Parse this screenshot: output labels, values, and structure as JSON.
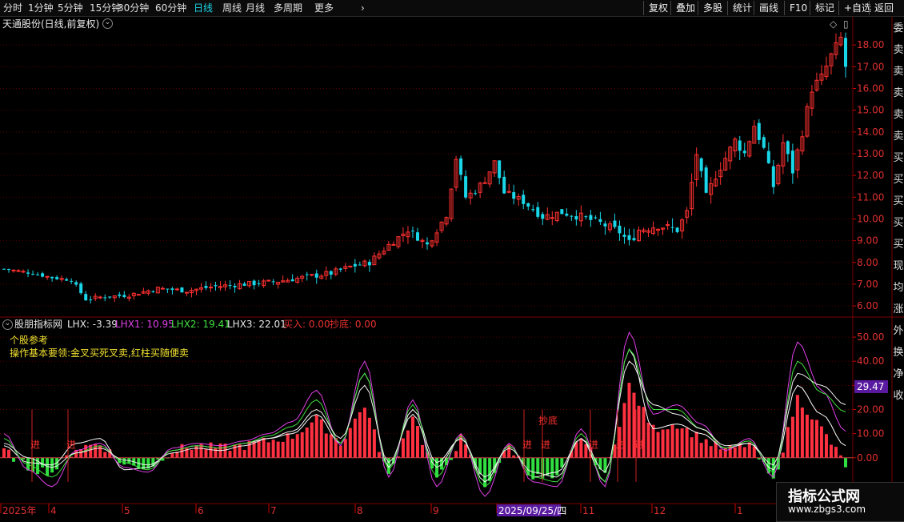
{
  "toolbar": {
    "periods": [
      "分时",
      "1分钟",
      "5分钟",
      "15分钟",
      "30分钟",
      "60分钟",
      "日线",
      "周线",
      "月线",
      "多周期",
      "更多"
    ],
    "active_period": "日线",
    "more_icon": "chevron-right-icon",
    "right_buttons": [
      "复权",
      "叠加",
      "多股",
      "统计",
      "画线",
      "F10",
      "标记",
      "+自选",
      "返回"
    ]
  },
  "main_chart": {
    "title": "天通股份(日线,前复权)",
    "dropdown_icon": "chevron-down-circle-icon",
    "price_ticks": [
      "18.00",
      "17.00",
      "16.00",
      "15.00",
      "14.00",
      "13.00",
      "12.00",
      "11.00",
      "10.00",
      "9.00",
      "8.00",
      "7.00",
      "6.00"
    ]
  },
  "indicator": {
    "name": "股朋指标网",
    "values": [
      {
        "label": "LHX: -3.39",
        "color": "#e8e8e8"
      },
      {
        "label": "LHX1: 10.95",
        "color": "#e040e8"
      },
      {
        "label": "LHX2: 19.41",
        "color": "#40e040"
      },
      {
        "label": "LHX3: 22.01",
        "color": "#e8e8e8"
      },
      {
        "label": "买入: 0.00",
        "color": "#e83030"
      },
      {
        "label": "抄底: 0.00",
        "color": "#e83030"
      }
    ],
    "notes": [
      "个股参考",
      "操作基本要领:金叉买死叉卖,红柱买随便卖"
    ],
    "axis_ticks": [
      "50.00",
      "40.00",
      "30.00",
      "20.00",
      "10.00",
      "0.00"
    ],
    "current_value": "29.47",
    "signal_jin": "进",
    "signal_chaodi": "抄底"
  },
  "x_axis": {
    "labels": [
      "2025年",
      "4",
      "5",
      "6",
      "7",
      "8",
      "9",
      "2025/09/25/四",
      "11",
      "12",
      "1"
    ]
  },
  "right_column": [
    "委",
    "卖",
    "卖",
    "卖",
    "卖",
    "卖",
    "买",
    "买",
    "买",
    "买",
    "买",
    "现",
    "均",
    "涨",
    "外",
    "换",
    "净",
    "收"
  ],
  "watermark": {
    "title": "指标公式网",
    "url": "www.zbgs3.com"
  },
  "colors": {
    "up": "#ff3030",
    "down": "#19d6e8",
    "bar_up": "#ff3040",
    "bar_down": "#30e040",
    "active": "#19d6e8",
    "grid": "#5a0000"
  },
  "chart_data": {
    "type": "candlestick",
    "price_range": [
      5.6,
      19.0
    ],
    "close_path": [
      [
        0,
        7.7
      ],
      [
        6,
        7.5
      ],
      [
        10,
        7.3
      ],
      [
        14,
        7.2
      ],
      [
        17,
        6.3
      ],
      [
        20,
        6.4
      ],
      [
        26,
        6.5
      ],
      [
        32,
        6.8
      ],
      [
        38,
        6.7
      ],
      [
        44,
        6.9
      ],
      [
        50,
        7.0
      ],
      [
        56,
        7.1
      ],
      [
        62,
        7.3
      ],
      [
        68,
        7.5
      ],
      [
        72,
        7.8
      ],
      [
        76,
        8.0
      ],
      [
        80,
        8.8
      ],
      [
        84,
        9.5
      ],
      [
        88,
        8.8
      ],
      [
        92,
        10.2
      ],
      [
        94,
        12.8
      ],
      [
        96,
        11.0
      ],
      [
        98,
        11.3
      ],
      [
        100,
        11.8
      ],
      [
        102,
        12.6
      ],
      [
        104,
        11.2
      ],
      [
        108,
        10.8
      ],
      [
        112,
        10.1
      ],
      [
        116,
        10.3
      ],
      [
        120,
        10.1
      ],
      [
        124,
        9.8
      ],
      [
        128,
        9.4
      ],
      [
        130,
        8.9
      ],
      [
        132,
        9.5
      ],
      [
        136,
        9.7
      ],
      [
        140,
        9.5
      ],
      [
        142,
        10.3
      ],
      [
        144,
        13.0
      ],
      [
        146,
        11.0
      ],
      [
        148,
        12.0
      ],
      [
        150,
        12.8
      ],
      [
        152,
        13.6
      ],
      [
        154,
        13.0
      ],
      [
        156,
        14.3
      ],
      [
        158,
        13.2
      ],
      [
        160,
        11.5
      ],
      [
        162,
        13.5
      ],
      [
        164,
        12.2
      ],
      [
        166,
        14.0
      ],
      [
        168,
        16.0
      ],
      [
        170,
        16.5
      ],
      [
        172,
        17.5
      ],
      [
        174,
        18.3
      ],
      [
        175,
        17.0
      ]
    ],
    "indicator_range": [
      -18,
      55
    ],
    "series": [
      {
        "name": "LHX",
        "values": [
          5,
          -2,
          -3,
          6,
          8,
          -5,
          -4,
          3,
          5,
          4,
          6,
          8,
          10,
          18,
          6,
          35,
          -4,
          20,
          -2,
          8,
          -10,
          5,
          -8,
          -6,
          8,
          -10,
          45,
          12,
          14,
          10,
          4,
          6,
          -5,
          30,
          18,
          5
        ]
      },
      {
        "name": "LHX1",
        "values": [
          10,
          -5,
          -12,
          3,
          6,
          -4,
          -6,
          4,
          6,
          5,
          7,
          10,
          15,
          28,
          5,
          40,
          -8,
          24,
          -12,
          10,
          -16,
          6,
          -10,
          -12,
          12,
          -12,
          52,
          18,
          22,
          14,
          3,
          8,
          -8,
          48,
          28,
          11
        ]
      },
      {
        "name": "LHX2",
        "values": [
          8,
          -3,
          -8,
          2,
          5,
          -2,
          -5,
          3,
          5,
          4,
          6,
          9,
          13,
          24,
          6,
          35,
          -5,
          22,
          -8,
          9,
          -12,
          5,
          -8,
          -10,
          10,
          -10,
          45,
          20,
          20,
          12,
          4,
          7,
          -6,
          40,
          27,
          19
        ]
      },
      {
        "name": "LHX3",
        "values": [
          6,
          0,
          -4,
          2,
          4,
          -1,
          -3,
          2,
          4,
          3,
          5,
          8,
          11,
          20,
          8,
          30,
          -2,
          18,
          -4,
          8,
          -8,
          4,
          -6,
          -8,
          8,
          -6,
          40,
          22,
          18,
          12,
          5,
          6,
          -3,
          35,
          30,
          22
        ]
      }
    ],
    "bars": [
      3,
      -4,
      -6,
      4,
      6,
      -3,
      -4,
      3,
      5,
      4,
      5,
      7,
      9,
      16,
      6,
      22,
      -8,
      18,
      -10,
      8,
      -12,
      5,
      -8,
      -9,
      9,
      -8,
      30,
      12,
      14,
      8,
      3,
      6,
      -10,
      25,
      12,
      -3
    ]
  }
}
